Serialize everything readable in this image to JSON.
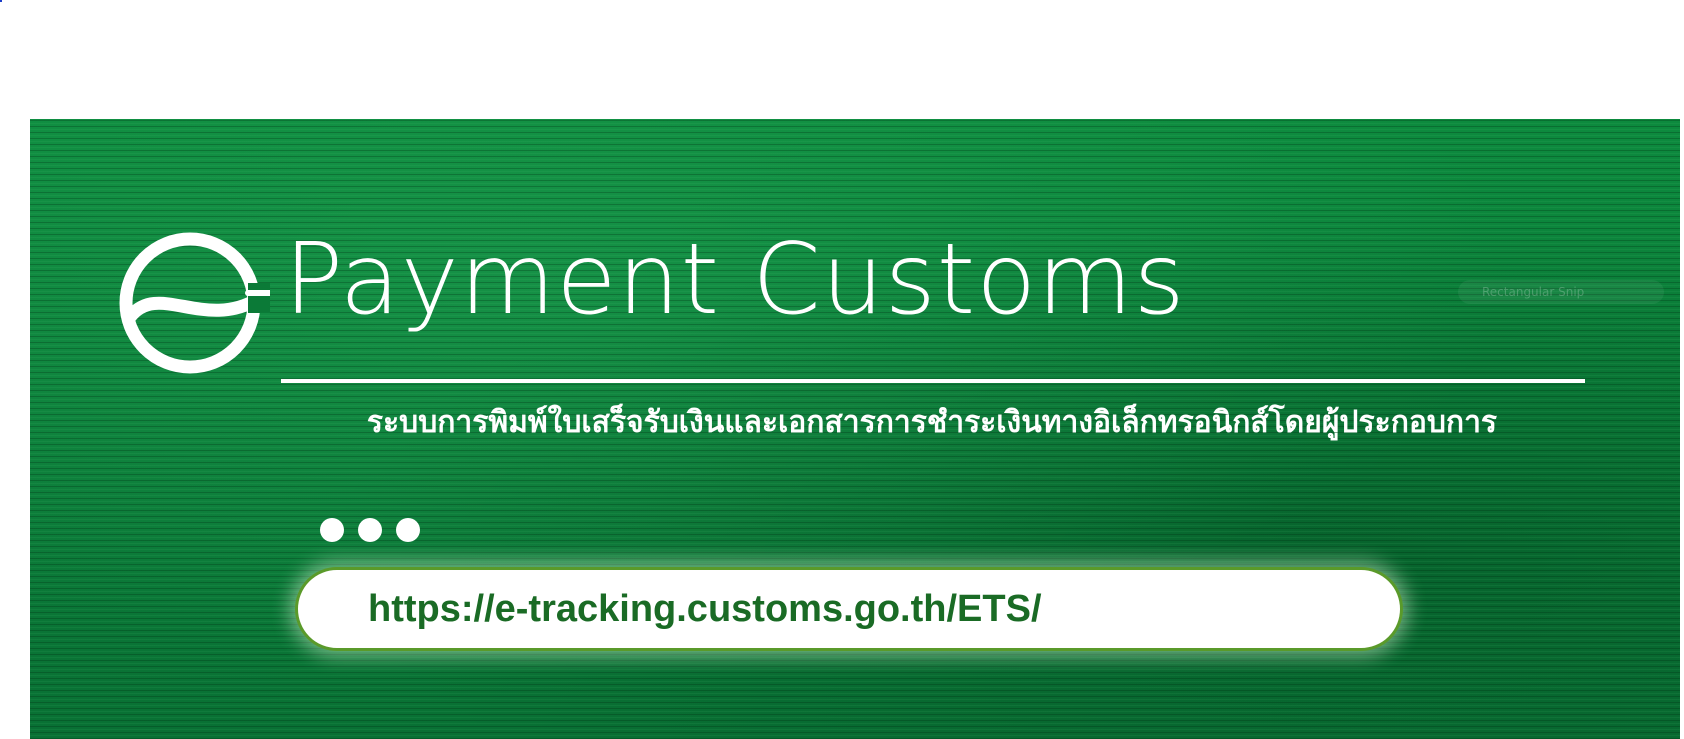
{
  "banner": {
    "logo_text": "Payment Customs",
    "subtitle": "ระบบการพิมพ์ใบเสร็จรับเงินและเอกสารการชำระเงินทางอิเล็กทรอนิกส์โดยผู้ประกอบการ",
    "watermark": "Rectangular Snip",
    "url": "https://e-tracking.customs.go.th/ETS/",
    "dot_count": 3
  },
  "colors": {
    "banner_green": "#0b7a37",
    "url_text": "#1a6b25",
    "pill_border": "#5a9a2a",
    "text_light": "#ffffff"
  },
  "icons": {
    "logo": "e-logo-icon",
    "dots": "ellipsis-icon"
  }
}
